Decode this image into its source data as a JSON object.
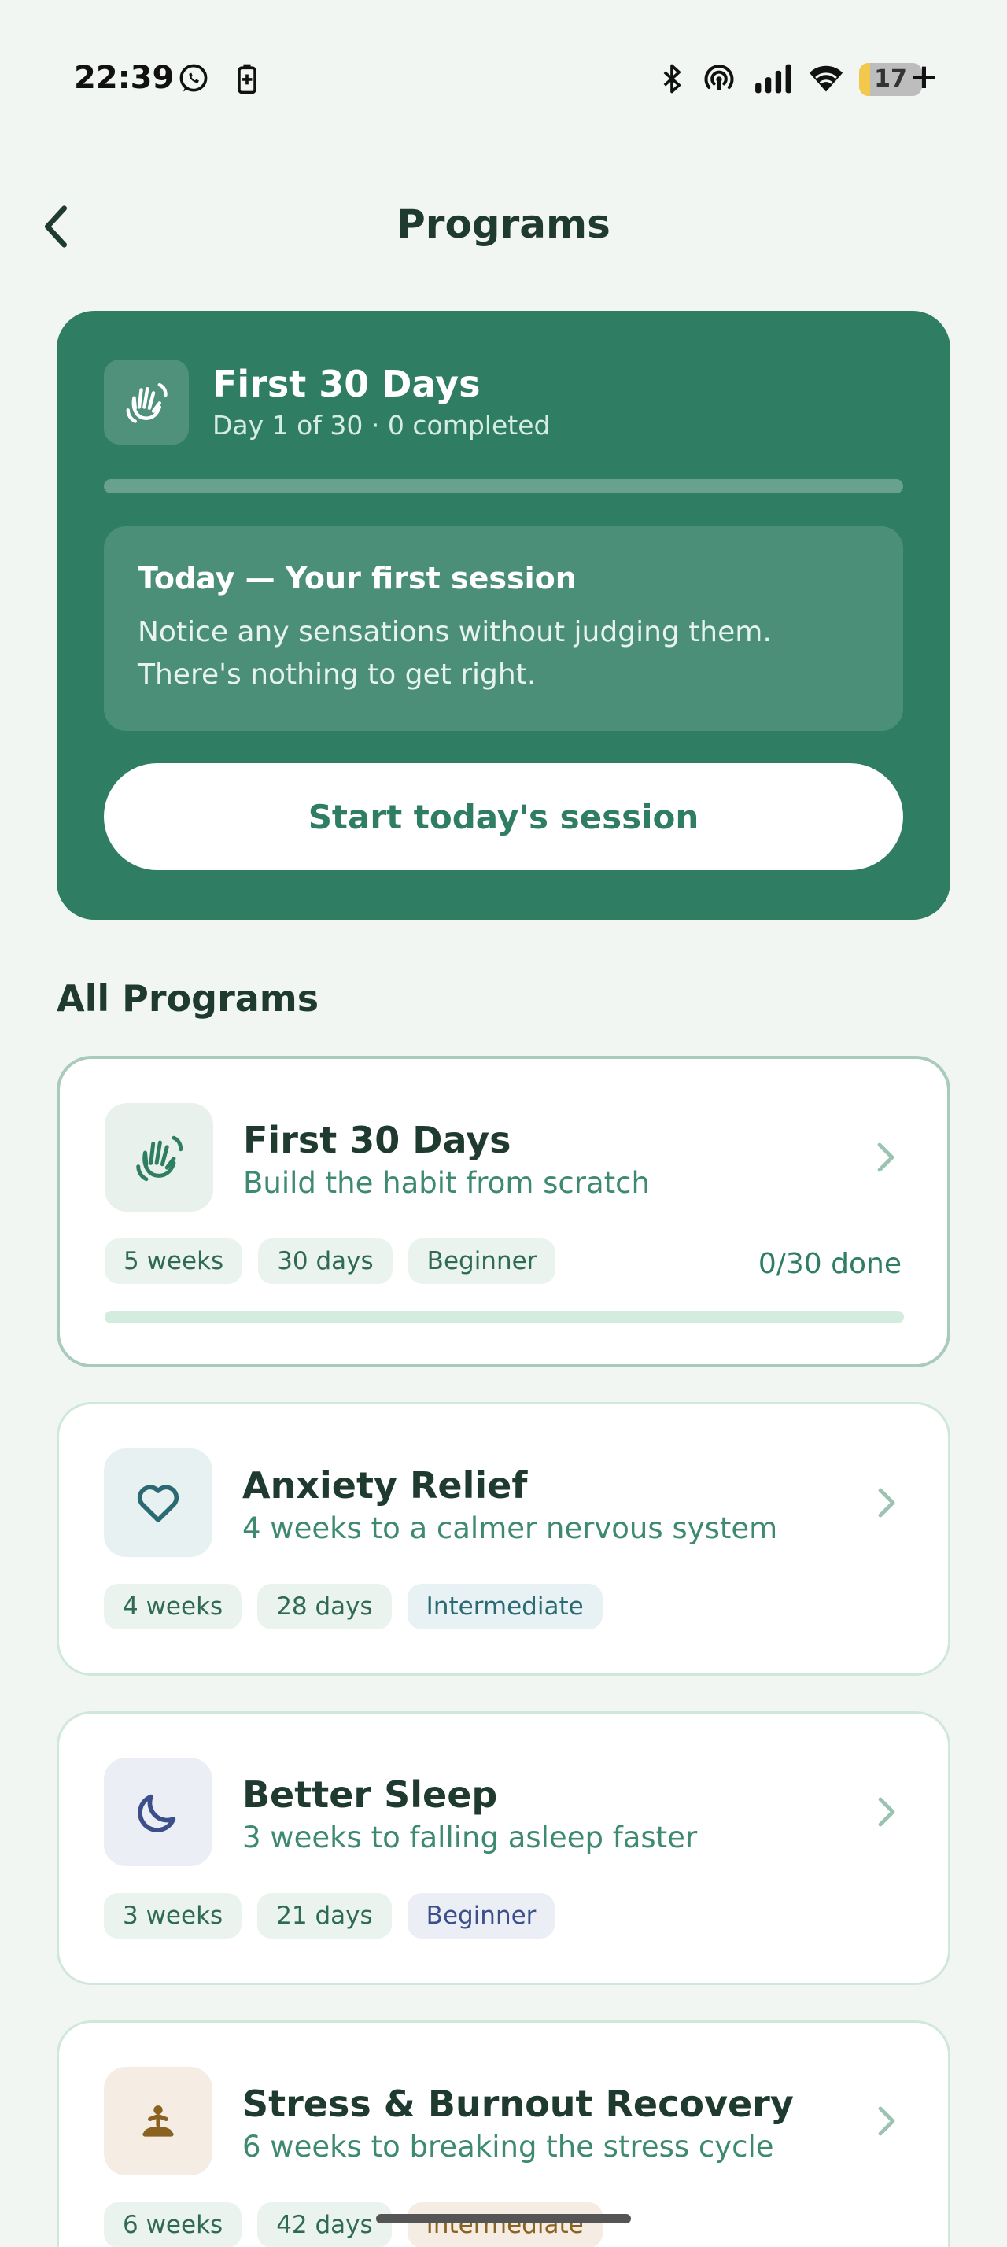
{
  "status_bar": {
    "time": "22:39",
    "battery_level": "17",
    "battery_fraction": 0.17,
    "left_icons": [
      "whatsapp-icon",
      "battery-saver-icon"
    ],
    "right_icons": [
      "bluetooth-icon",
      "hotspot-icon",
      "signal-icon",
      "wifi-icon",
      "battery-icon"
    ]
  },
  "header": {
    "title": "Programs",
    "back_icon": "chevron-left-icon"
  },
  "current_program": {
    "icon": "waving-hand-icon",
    "title": "First 30 Days",
    "subtitle": "Day 1 of 30 · 0 completed",
    "progress": 0,
    "today_title": "Today — Your first session",
    "today_body": "Notice any sensations without judging them. There's nothing to get right.",
    "start_label": "Start today's session"
  },
  "all_programs": {
    "heading": "All Programs",
    "items": [
      {
        "icon": "waving-hand-icon",
        "title": "First 30 Days",
        "subtitle": "Build the habit from scratch",
        "chips": [
          "5 weeks",
          "30 days",
          "Beginner"
        ],
        "done": "0/30 done",
        "progress": 0
      },
      {
        "icon": "heart-icon",
        "title": "Anxiety Relief",
        "subtitle": "4 weeks to a calmer nervous system",
        "chips": [
          "4 weeks",
          "28 days",
          "Intermediate"
        ]
      },
      {
        "icon": "moon-icon",
        "title": "Better Sleep",
        "subtitle": "3 weeks to falling asleep faster",
        "chips": [
          "3 weeks",
          "21 days",
          "Beginner"
        ]
      },
      {
        "icon": "meditation-icon",
        "title": "Stress & Burnout Recovery",
        "subtitle": "6 weeks to breaking the stress cycle",
        "chips": [
          "6 weeks",
          "42 days",
          "Intermediate"
        ]
      }
    ]
  },
  "colors": {
    "primary": "#2f7d62",
    "background": "#f1f6f3",
    "text_dark": "#1f3b30",
    "accent_text": "#3e8a70"
  }
}
